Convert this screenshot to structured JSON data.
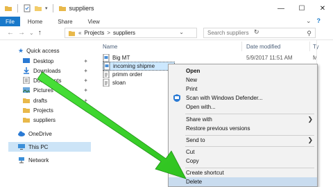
{
  "window": {
    "title": "suppliers",
    "controls": {
      "minimize": "—",
      "maximize": "☐",
      "close": "✕"
    }
  },
  "ribbon": {
    "tabs": [
      "File",
      "Home",
      "Share",
      "View"
    ],
    "expand": "⌄",
    "help": "?"
  },
  "address": {
    "back": "←",
    "forward": "→",
    "recent": "⌄",
    "up": "↑",
    "prefix": "«",
    "crumbs": [
      "Projects",
      "suppliers"
    ],
    "separator": ">",
    "dropdown": "⌄",
    "refresh": "↻"
  },
  "search": {
    "placeholder": "Search suppliers",
    "icon": "search-icon"
  },
  "nav": {
    "items": [
      {
        "label": "Quick access",
        "icon": "star-icon",
        "pinned": false,
        "selected": false
      },
      {
        "label": "Desktop",
        "icon": "desktop-icon",
        "pinned": true,
        "selected": false
      },
      {
        "label": "Downloads",
        "icon": "download-icon",
        "pinned": true,
        "selected": false
      },
      {
        "label": "Documents",
        "icon": "documents-icon",
        "pinned": true,
        "selected": false
      },
      {
        "label": "Pictures",
        "icon": "pictures-icon",
        "pinned": true,
        "selected": false
      },
      {
        "label": "drafts",
        "icon": "folder-icon",
        "pinned": true,
        "selected": false
      },
      {
        "label": "Projects",
        "icon": "folder-icon",
        "pinned": true,
        "selected": false
      },
      {
        "label": "suppliers",
        "icon": "folder-icon",
        "pinned": false,
        "selected": false
      },
      {
        "label": "OneDrive",
        "icon": "cloud-icon",
        "pinned": false,
        "selected": false
      },
      {
        "label": "This PC",
        "icon": "computer-icon",
        "pinned": false,
        "selected": true
      },
      {
        "label": "Network",
        "icon": "network-icon",
        "pinned": false,
        "selected": false
      }
    ],
    "pin_glyph": "📌"
  },
  "columns": {
    "name": "Name",
    "date": "Date modified",
    "type": "Ty"
  },
  "files": [
    {
      "name": "Big MT",
      "date": "5/9/2017 11:51 AM",
      "type": "M",
      "selected": false
    },
    {
      "name": "incoming shipme",
      "date": "",
      "type": "",
      "selected": true
    },
    {
      "name": "primm order",
      "date": "",
      "type": "",
      "selected": false
    },
    {
      "name": "sloan",
      "date": "",
      "type": "",
      "selected": false
    }
  ],
  "context_menu": {
    "items": [
      {
        "label": "Open",
        "bold": true,
        "arrow": false
      },
      {
        "label": "New",
        "bold": false,
        "arrow": false
      },
      {
        "label": "Print",
        "bold": false,
        "arrow": false
      },
      {
        "label": "Scan with Windows Defender...",
        "bold": false,
        "arrow": false,
        "icon": "defender-icon"
      },
      {
        "label": "Open with...",
        "bold": false,
        "arrow": false
      },
      {
        "label": "Share with",
        "bold": false,
        "arrow": true
      },
      {
        "label": "Restore previous versions",
        "bold": false,
        "arrow": false
      },
      {
        "label": "Send to",
        "bold": false,
        "arrow": true
      },
      {
        "label": "Cut",
        "bold": false,
        "arrow": false
      },
      {
        "label": "Copy",
        "bold": false,
        "arrow": false
      },
      {
        "label": "Create shortcut",
        "bold": false,
        "arrow": false
      },
      {
        "label": "Delete",
        "bold": false,
        "arrow": false,
        "highlighted": true
      }
    ],
    "submenu_arrow": "❯"
  },
  "colors": {
    "file_tab": "#1979ca",
    "selection": "#cce8ff",
    "nav_selection": "#cce4f7",
    "menu_bg": "#f2f2f2",
    "menu_highlight": "#c9dcef",
    "annotation_arrow": "#3ddc2c",
    "folder": "#e8b84a"
  }
}
